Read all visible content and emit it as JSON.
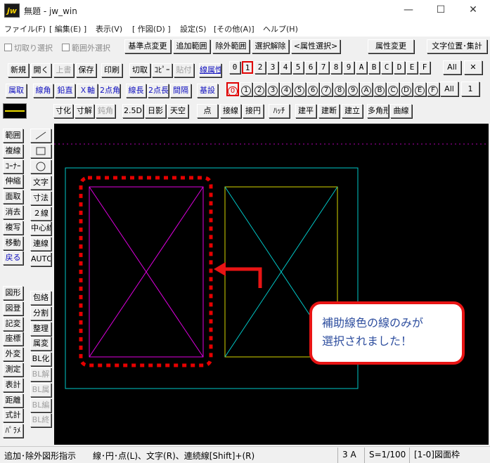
{
  "window": {
    "title": "無題 - jw_win",
    "app_icon_text": "jw",
    "minimize_glyph": "—",
    "maximize_glyph": "☐",
    "close_glyph": "✕"
  },
  "menu": [
    "ファイル(F)",
    "[ 編集(E) ]",
    "表示(V)",
    "[ 作図(D) ]",
    "設定(S)",
    "[その他(A)]",
    "ヘルプ(H)"
  ],
  "toolbar1": {
    "cutoff_select": "切取り選択",
    "outside_range_select": "範囲外選択",
    "base_point_change": "基準点変更",
    "add_range": "追加範囲",
    "exclude_range": "除外範囲",
    "clear_selection": "選択解除",
    "attribute_select": "<属性選択>",
    "attribute_change": "属性変更",
    "text_position_total": "文字位置･集計"
  },
  "toolbar2": {
    "new": "新規",
    "open": "開く",
    "overwrite": "上書",
    "save": "保存",
    "print": "印刷",
    "cut": "切取",
    "copy": "ｺﾋﾟｰ",
    "paste": "貼付",
    "line_attr": "線属性",
    "layer_group_buttons": [
      "0",
      "1",
      "2",
      "3",
      "4",
      "5",
      "6",
      "7",
      "8",
      "9",
      "A",
      "B",
      "C",
      "D",
      "E",
      "F"
    ],
    "selected_layer_group": "1",
    "all": "All",
    "x": "✕"
  },
  "toolbar3": {
    "attr_get": "属取",
    "line_angle": "線角",
    "vertical": "鉛直",
    "x_axis": "Ｘ軸",
    "two_point_angle": "2点角",
    "line_length": "線長",
    "two_point_length": "2点長",
    "interval": "間隔",
    "reference_setting": "基設",
    "layer_buttons": [
      "0",
      "1",
      "2",
      "3",
      "4",
      "5",
      "6",
      "7",
      "8",
      "9",
      "A",
      "B",
      "C",
      "D",
      "E",
      "F"
    ],
    "selected_layer": "0",
    "all": "All",
    "one": "1"
  },
  "toolbar4": {
    "dim_setting": "寸化",
    "dim_release": "寸解",
    "obtuse": "鈍角",
    "view_2_5d": "2.5D",
    "sun_shadow": "日影",
    "sky_view": "天空",
    "point": "点",
    "tangent_line": "接線",
    "tangent_circle": "接円",
    "hatch": "ﾊｯﾁ",
    "building_plan": "建平",
    "building_section": "建断",
    "building_elevation": "建立",
    "polygon": "多角形",
    "curve": "曲線"
  },
  "left_tools": {
    "col1": [
      "範囲",
      "複線",
      "ｺｰﾅｰ",
      "伸縮",
      "面取",
      "消去",
      "複写",
      "移動",
      "戻る"
    ],
    "col2": [
      "文字",
      "寸法",
      "２線",
      "中心線",
      "連線",
      "AUTO"
    ],
    "col1_lower": [
      "図形",
      "図登",
      "記変",
      "座標",
      "外変",
      "測定",
      "表計",
      "距離",
      "式計",
      "ﾊﾟﾗﾒ"
    ],
    "col2_lower": [
      "包絡",
      "分割",
      "整理",
      "属変",
      "BL化",
      "BL解",
      "BL属",
      "BL編",
      "BL終"
    ]
  },
  "callout": {
    "line1": "補助線色の線のみが",
    "line2": "選択されました！"
  },
  "status": {
    "message": "追加･除外図形指示　　線･円･点(L)、文字(R)、連続線[Shift]+(R)",
    "layer": "3 A",
    "scale": "S=1/100",
    "frame": "[1-0]図面枠"
  },
  "colors": {
    "canvas_bg": "#000000",
    "auxiliary_line": "#ff00ff",
    "frame_cyan": "#00c8c8",
    "rect_yellow": "#d6d600",
    "selection_dash": "#e60000",
    "callout_border": "#e81414",
    "callout_text": "#2f4f9f"
  }
}
